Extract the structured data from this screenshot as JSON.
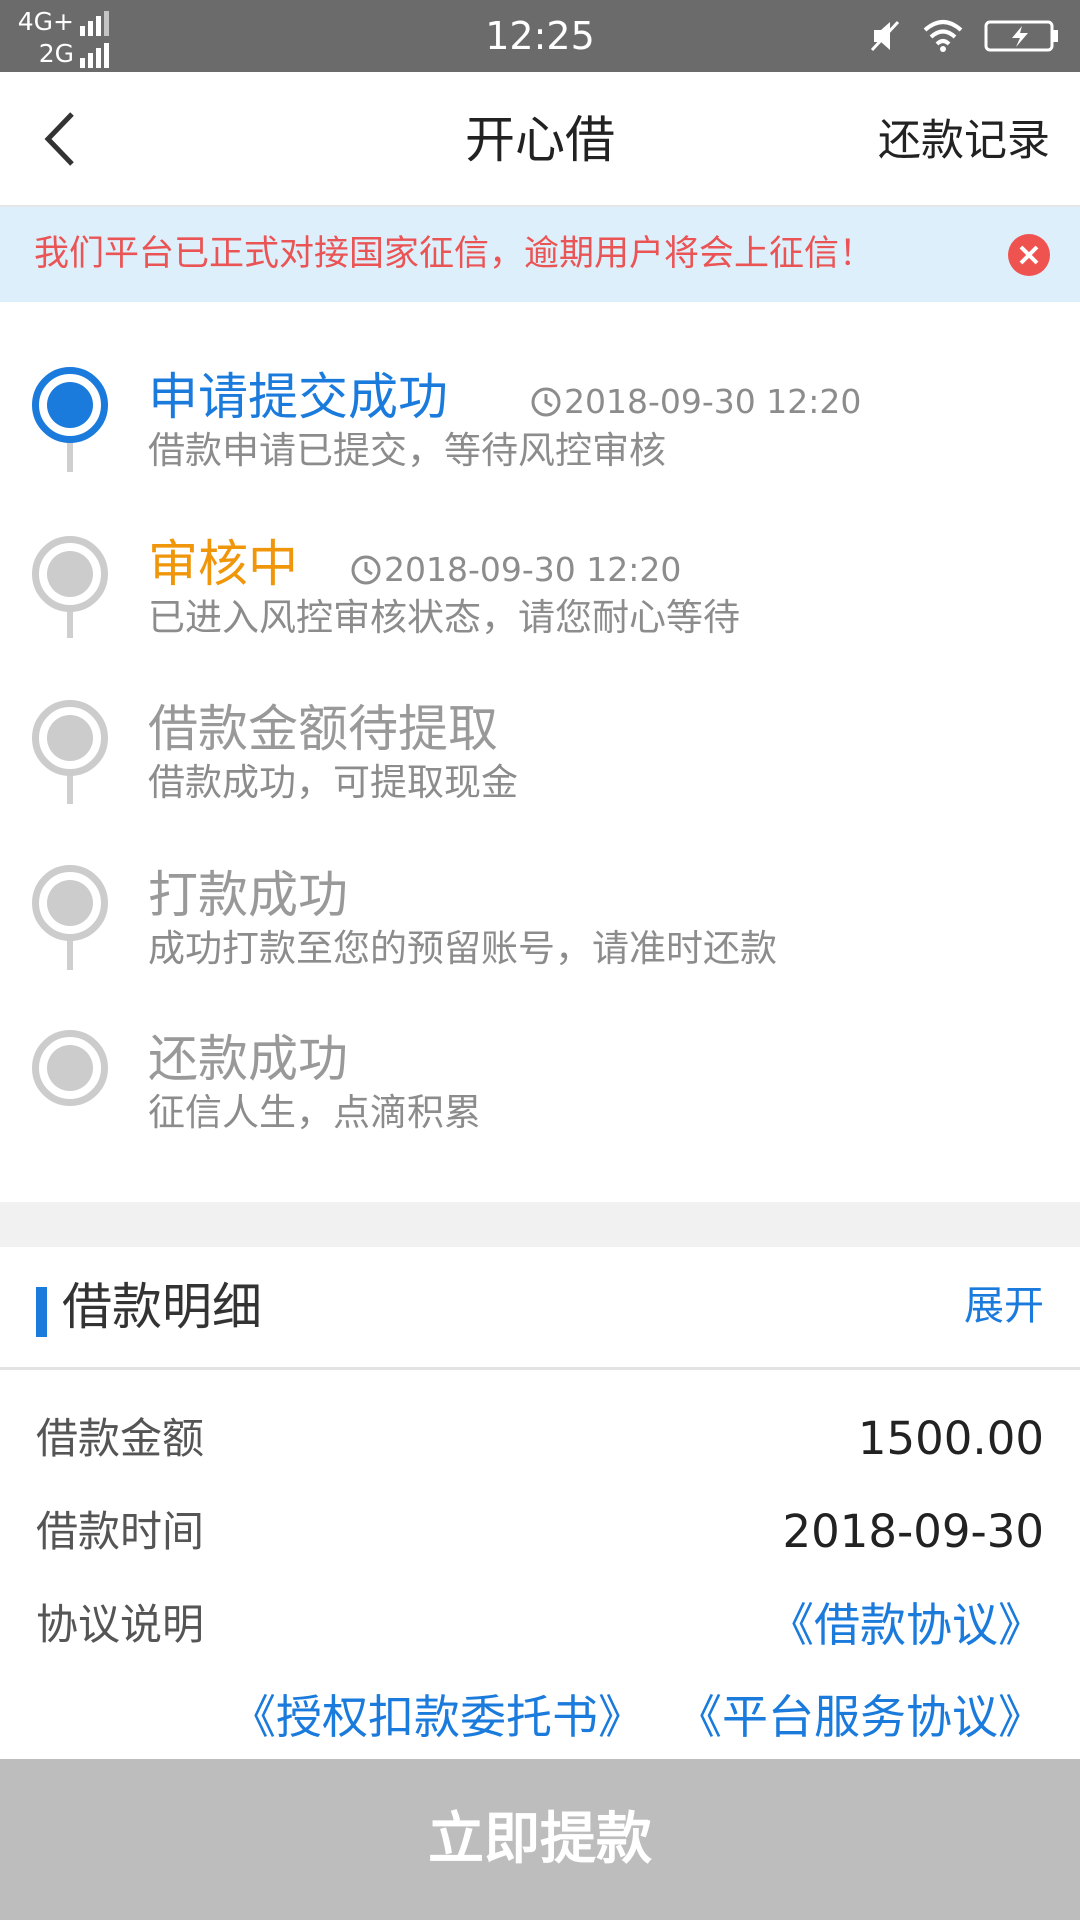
{
  "status_bar": {
    "network_top": "4G+",
    "network_bottom": "2G",
    "time": "12:25",
    "icons": [
      "signal-bars-icon",
      "mute-icon",
      "wifi-icon",
      "battery-charging-icon"
    ]
  },
  "nav": {
    "back_icon": "chevron-left-icon",
    "title": "开心借",
    "right_link": "还款记录"
  },
  "notice": {
    "text": "我们平台已正式对接国家征信，逾期用户将会上征信！",
    "close_icon": "close-icon",
    "close_color": "#ef5350"
  },
  "steps": [
    {
      "title": "申请提交成功",
      "time": "2018-09-30 12:20",
      "desc": "借款申请已提交，等待风控审核",
      "state": "done",
      "color": "#1a7bdc"
    },
    {
      "title": "审核中",
      "time": "2018-09-30 12:20",
      "desc": "已进入风控审核状态，请您耐心等待",
      "state": "current",
      "color": "#f0960a"
    },
    {
      "title": "借款金额待提取",
      "desc": "借款成功，可提取现金",
      "state": "pending"
    },
    {
      "title": "打款成功",
      "desc": "成功打款至您的预留账号，请准时还款",
      "state": "pending"
    },
    {
      "title": "还款成功",
      "desc": "征信人生，点滴积累",
      "state": "pending"
    }
  ],
  "details": {
    "title": "借款明细",
    "expand": "展开",
    "rows": [
      {
        "label": "借款金额",
        "value": "1500.00"
      },
      {
        "label": "借款时间",
        "value": "2018-09-30"
      }
    ],
    "agreement_label": "协议说明",
    "links": [
      "《借款协议》",
      "《授权扣款委托书》",
      "《平台服务协议》"
    ]
  },
  "bottom_button": {
    "label": "立即提款",
    "color": "#bdbdbd"
  },
  "colors": {
    "accent": "#1a7bdc",
    "warning": "#f0960a",
    "notice_bg": "#ddeffb",
    "notice_text": "#ea5454"
  }
}
